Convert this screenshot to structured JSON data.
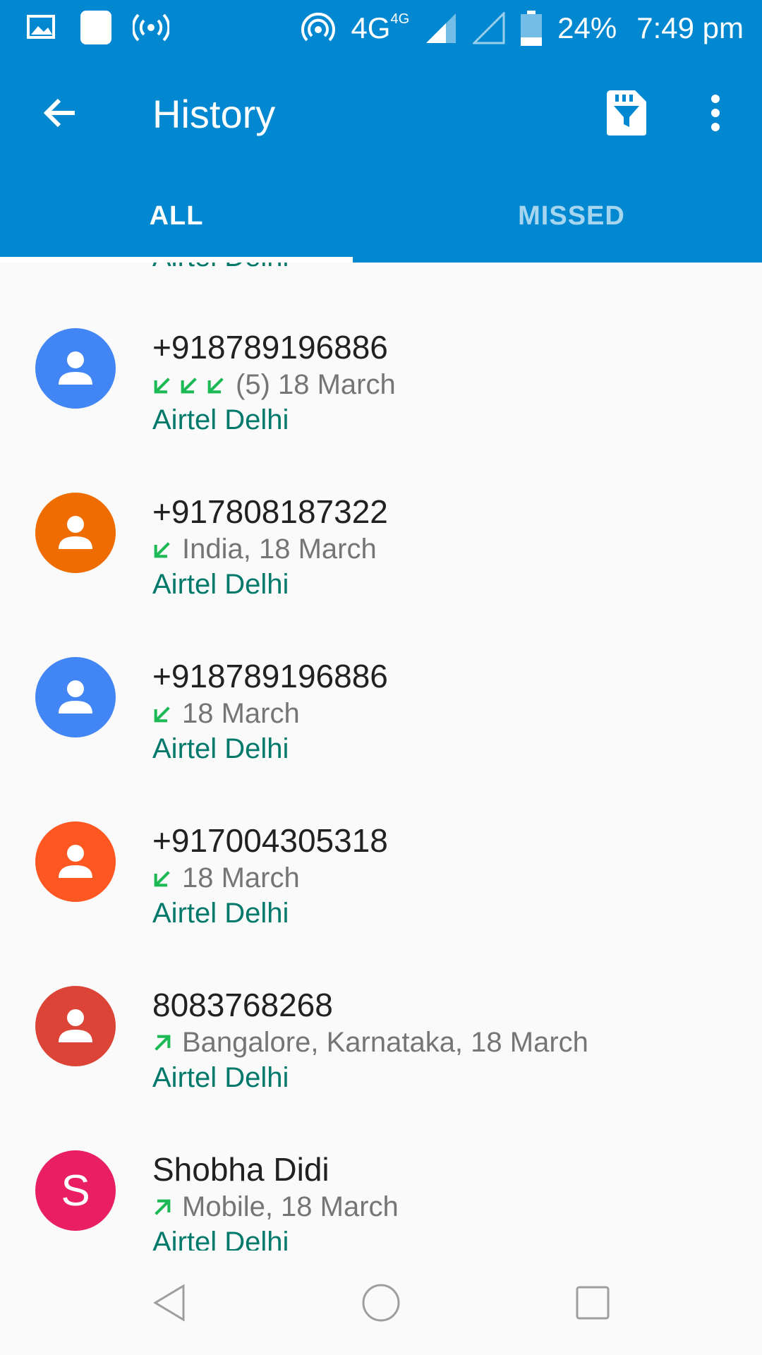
{
  "status_bar": {
    "icons_left": [
      "image-icon",
      "app-square-icon",
      "broadcast-icon"
    ],
    "network": "4G",
    "network_small": "4G",
    "battery": "24%",
    "time": "7:49 pm"
  },
  "toolbar": {
    "title": "History",
    "back_icon": "arrow-back-icon",
    "filter_icon": "sim-filter-icon",
    "more_icon": "more-vert-icon"
  },
  "tabs": [
    {
      "label": "ALL",
      "active": true
    },
    {
      "label": "MISSED",
      "active": false
    }
  ],
  "partial_top_carrier": "Airtel Delhi",
  "calls": [
    {
      "name": "+918789196886",
      "detail": "(5) 18 March",
      "call_type": "incoming",
      "arrow_count": 3,
      "carrier": "Airtel Delhi",
      "avatar_color": "#4285f4",
      "avatar_letter": ""
    },
    {
      "name": "+917808187322",
      "detail": "India, 18 March",
      "call_type": "incoming",
      "arrow_count": 1,
      "carrier": "Airtel Delhi",
      "avatar_color": "#ef6c00",
      "avatar_letter": ""
    },
    {
      "name": "+918789196886",
      "detail": "18 March",
      "call_type": "incoming",
      "arrow_count": 1,
      "carrier": "Airtel Delhi",
      "avatar_color": "#4285f4",
      "avatar_letter": ""
    },
    {
      "name": "+917004305318",
      "detail": "18 March",
      "call_type": "incoming",
      "arrow_count": 1,
      "carrier": "Airtel Delhi",
      "avatar_color": "#ff5722",
      "avatar_letter": ""
    },
    {
      "name": "8083768268",
      "detail": "Bangalore, Karnataka, 18 March",
      "call_type": "outgoing",
      "arrow_count": 1,
      "carrier": "Airtel Delhi",
      "avatar_color": "#db4437",
      "avatar_letter": ""
    },
    {
      "name": "Shobha Didi",
      "detail": "Mobile, 18 March",
      "call_type": "outgoing",
      "arrow_count": 1,
      "carrier": "Airtel Delhi",
      "avatar_color": "#e91e63",
      "avatar_letter": "S"
    }
  ],
  "colors": {
    "appbar": "#0288d1",
    "carrier_text": "#00796b",
    "arrow_green": "#1db954"
  },
  "nav_bar": [
    "back-triangle-icon",
    "home-circle-icon",
    "recents-square-icon"
  ]
}
